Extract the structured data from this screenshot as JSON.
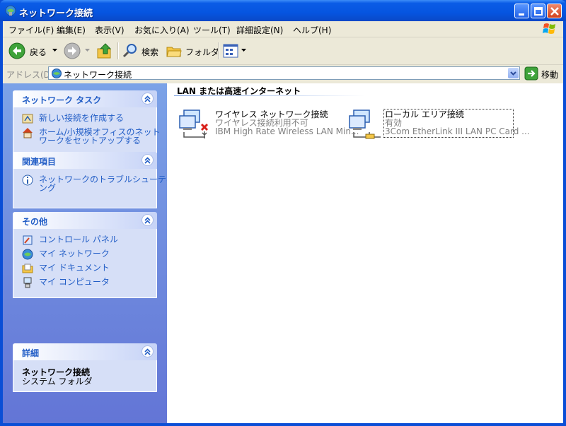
{
  "window": {
    "title": "ネットワーク接続"
  },
  "menu": [
    "ファイル(F)",
    "編集(E)",
    "表示(V)",
    "お気に入り(A)",
    "ツール(T)",
    "詳細設定(N)",
    "ヘルプ(H)"
  ],
  "toolbar": {
    "back_label": "戻る",
    "search_label": "検索",
    "folders_label": "フォルダ"
  },
  "address": {
    "label": "アドレス(D)",
    "value": "ネットワーク接続",
    "go_label": "移動"
  },
  "panels": {
    "network_tasks": {
      "title": "ネットワーク タスク",
      "items": [
        "新しい接続を作成する",
        "ホーム/小規模オフィスのネット",
        "ワークをセットアップする"
      ]
    },
    "related": {
      "title": "関連項目",
      "items": [
        "ネットワークのトラブルシューティ",
        "ング"
      ]
    },
    "other": {
      "title": "その他",
      "items": [
        "コントロール パネル",
        "マイ ネットワーク",
        "マイ ドキュメント",
        "マイ コンピュータ"
      ]
    },
    "details": {
      "title": "詳細",
      "name": "ネットワーク接続",
      "type": "システム フォルダ"
    }
  },
  "group": {
    "title": "LAN または高速インターネット"
  },
  "connections": [
    {
      "name": "ワイヤレス ネットワーク接続",
      "status": "ワイヤレス接続利用不可",
      "device": "IBM High Rate Wireless LAN Min..."
    },
    {
      "name": "ローカル エリア接続",
      "status": "有効",
      "device": "3Com EtherLink III LAN PC Card ..."
    }
  ]
}
